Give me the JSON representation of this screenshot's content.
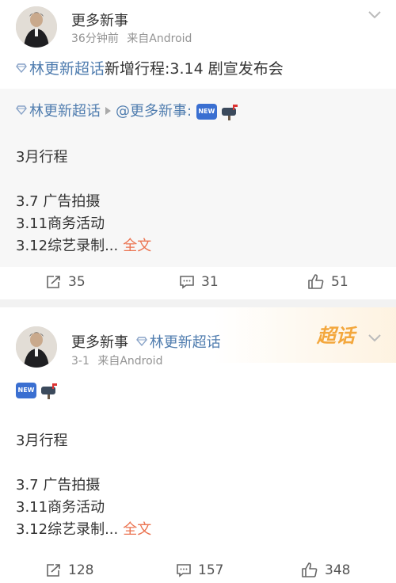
{
  "post1": {
    "username": "更多新事",
    "time": "36分钟前",
    "source": "来自Android",
    "topic": "林更新超话",
    "headline_text": "新增行程:3.14 剧宣发布会",
    "repost": {
      "topic": "林更新超话",
      "mention": "@更多新事:",
      "badge": "NEW"
    },
    "lines": [
      "3月行程",
      "3.7  广告拍摄",
      "3.11商务活动",
      "3.12综艺录制..."
    ],
    "fulltext_label": "全文",
    "actions": {
      "reposts": "35",
      "comments": "31",
      "likes": "51"
    }
  },
  "post2": {
    "username": "更多新事",
    "topic": "林更新超话",
    "time": "3-1",
    "source": "来自Android",
    "chaohua_label": "超话",
    "badge": "NEW",
    "lines": [
      "3月行程",
      "3.7  广告拍摄",
      "3.11商务活动",
      "3.12综艺录制..."
    ],
    "fulltext_label": "全文",
    "actions": {
      "reposts": "128",
      "comments": "157",
      "likes": "348"
    }
  },
  "colors": {
    "topic": "#eb7350",
    "link": "#507daf",
    "meta": "#939393",
    "chaohua": "#f3a73d"
  },
  "icons": [
    "diamond-icon",
    "chevron-down-icon",
    "repost-icon",
    "comment-icon",
    "like-icon",
    "mailbox-icon"
  ]
}
